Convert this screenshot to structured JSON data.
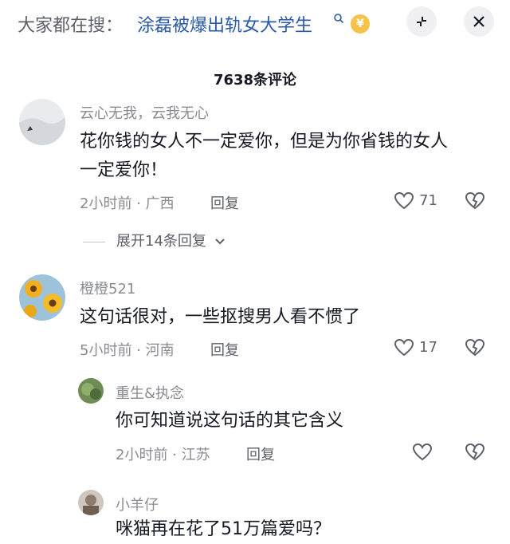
{
  "search": {
    "prefix": "大家都在搜：",
    "term": "涂磊被爆出轨女大学生",
    "coin_icon": "coin-icon",
    "coin_symbol": "¥"
  },
  "comments_count": "7638条评论",
  "comments": [
    {
      "user": "云心无我，云我无心",
      "text_line1": "花你钱的女人不一定爱你，但是为你省钱的女人",
      "text_line2": "一定爱你！",
      "time": "2小时前",
      "location": "广西",
      "reply_label": "回复",
      "likes": "71",
      "expand_label": "展开14条回复"
    },
    {
      "user": "橙橙521",
      "text": "这句话很对，一些抠搜男人看不惯了",
      "time": "5小时前",
      "location": "河南",
      "reply_label": "回复",
      "likes": "17"
    }
  ],
  "replies": [
    {
      "user": "重生&执念",
      "text": "你可知道说这句话的其它含义",
      "time": "2小时前",
      "location": "江苏",
      "reply_label": "回复"
    },
    {
      "user": "小羊仔",
      "text": "咪猫再在花了51万篇爱吗？"
    }
  ],
  "colors": {
    "link": "#2a5aa9",
    "muted": "#8a8b91",
    "text": "#161823"
  }
}
